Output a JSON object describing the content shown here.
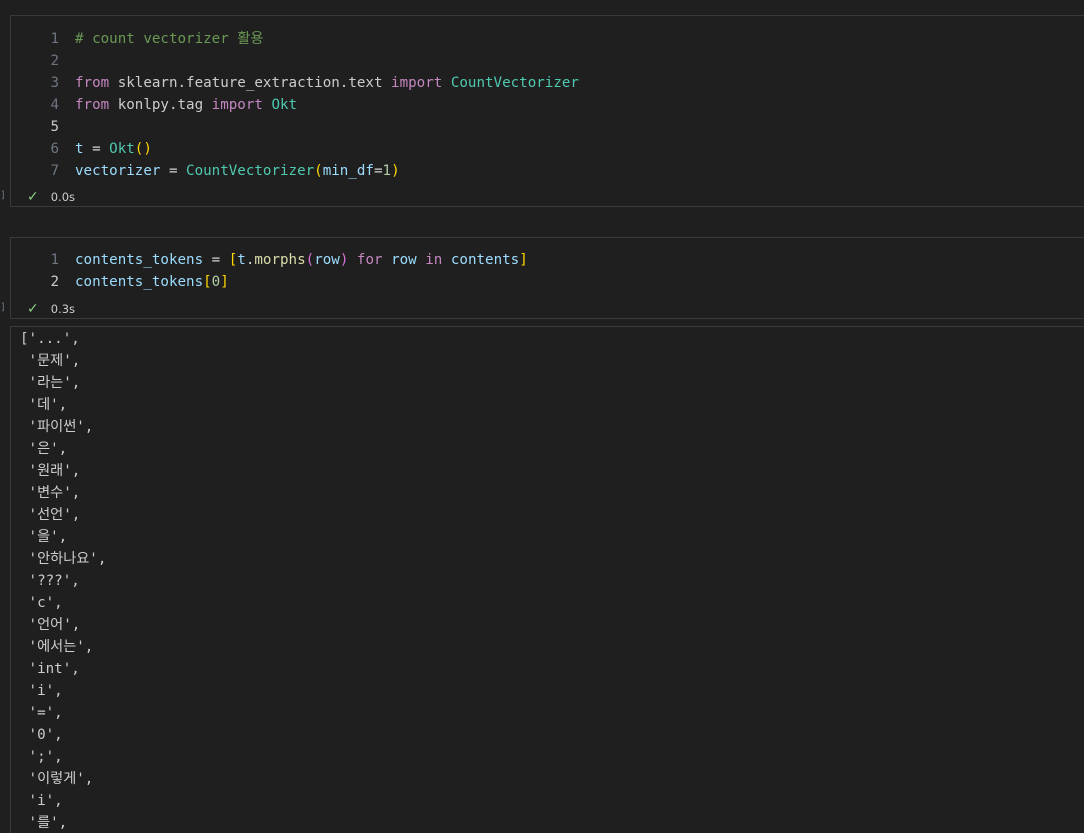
{
  "cell1": {
    "lines": [
      {
        "n": "1",
        "tokens": [
          {
            "t": "# count vectorizer 활용",
            "c": "comment"
          }
        ]
      },
      {
        "n": "2",
        "tokens": []
      },
      {
        "n": "3",
        "tokens": [
          {
            "t": "from",
            "c": "keyword"
          },
          {
            "t": " sklearn.feature_extraction.text ",
            "c": "module"
          },
          {
            "t": "import",
            "c": "keyword"
          },
          {
            "t": " ",
            "c": "op"
          },
          {
            "t": "CountVectorizer",
            "c": "class"
          }
        ]
      },
      {
        "n": "4",
        "tokens": [
          {
            "t": "from",
            "c": "keyword"
          },
          {
            "t": " konlpy.tag ",
            "c": "module"
          },
          {
            "t": "import",
            "c": "keyword"
          },
          {
            "t": " ",
            "c": "op"
          },
          {
            "t": "Okt",
            "c": "class"
          }
        ]
      },
      {
        "n": "5",
        "tokens": [],
        "active": true
      },
      {
        "n": "6",
        "tokens": [
          {
            "t": "t",
            "c": "ident"
          },
          {
            "t": " = ",
            "c": "op"
          },
          {
            "t": "Okt",
            "c": "class"
          },
          {
            "t": "()",
            "c": "br1"
          }
        ]
      },
      {
        "n": "7",
        "tokens": [
          {
            "t": "vectorizer",
            "c": "ident"
          },
          {
            "t": " = ",
            "c": "op"
          },
          {
            "t": "CountVectorizer",
            "c": "class"
          },
          {
            "t": "(",
            "c": "br1"
          },
          {
            "t": "min_df",
            "c": "ident"
          },
          {
            "t": "=",
            "c": "op"
          },
          {
            "t": "1",
            "c": "num"
          },
          {
            "t": ")",
            "c": "br1"
          }
        ]
      }
    ],
    "status_time": "0.0s"
  },
  "cell2": {
    "lines": [
      {
        "n": "1",
        "tokens": [
          {
            "t": "contents_tokens",
            "c": "ident"
          },
          {
            "t": " = ",
            "c": "op"
          },
          {
            "t": "[",
            "c": "br1"
          },
          {
            "t": "t",
            "c": "ident"
          },
          {
            "t": ".",
            "c": "op"
          },
          {
            "t": "morphs",
            "c": "func"
          },
          {
            "t": "(",
            "c": "br2"
          },
          {
            "t": "row",
            "c": "ident"
          },
          {
            "t": ")",
            "c": "br2"
          },
          {
            "t": " ",
            "c": "op"
          },
          {
            "t": "for",
            "c": "keyword"
          },
          {
            "t": " ",
            "c": "op"
          },
          {
            "t": "row",
            "c": "ident"
          },
          {
            "t": " ",
            "c": "op"
          },
          {
            "t": "in",
            "c": "keyword"
          },
          {
            "t": " ",
            "c": "op"
          },
          {
            "t": "contents",
            "c": "ident"
          },
          {
            "t": "]",
            "c": "br1"
          }
        ]
      },
      {
        "n": "2",
        "tokens": [
          {
            "t": "contents_tokens",
            "c": "ident"
          },
          {
            "t": "[",
            "c": "br1"
          },
          {
            "t": "0",
            "c": "num"
          },
          {
            "t": "]",
            "c": "br1"
          }
        ],
        "active": true
      }
    ],
    "status_time": "0.3s"
  },
  "output_lines": [
    "['...',",
    " '문제',",
    " '라는',",
    " '데',",
    " '파이썬',",
    " '은',",
    " '원래',",
    " '변수',",
    " '선언',",
    " '을',",
    " '안하나요',",
    " '???',",
    " 'c',",
    " '언어',",
    " '에서는',",
    " 'int',",
    " 'i',",
    " '=',",
    " '0',",
    " ';',",
    " '이렇게',",
    " 'i',",
    " '를',"
  ]
}
